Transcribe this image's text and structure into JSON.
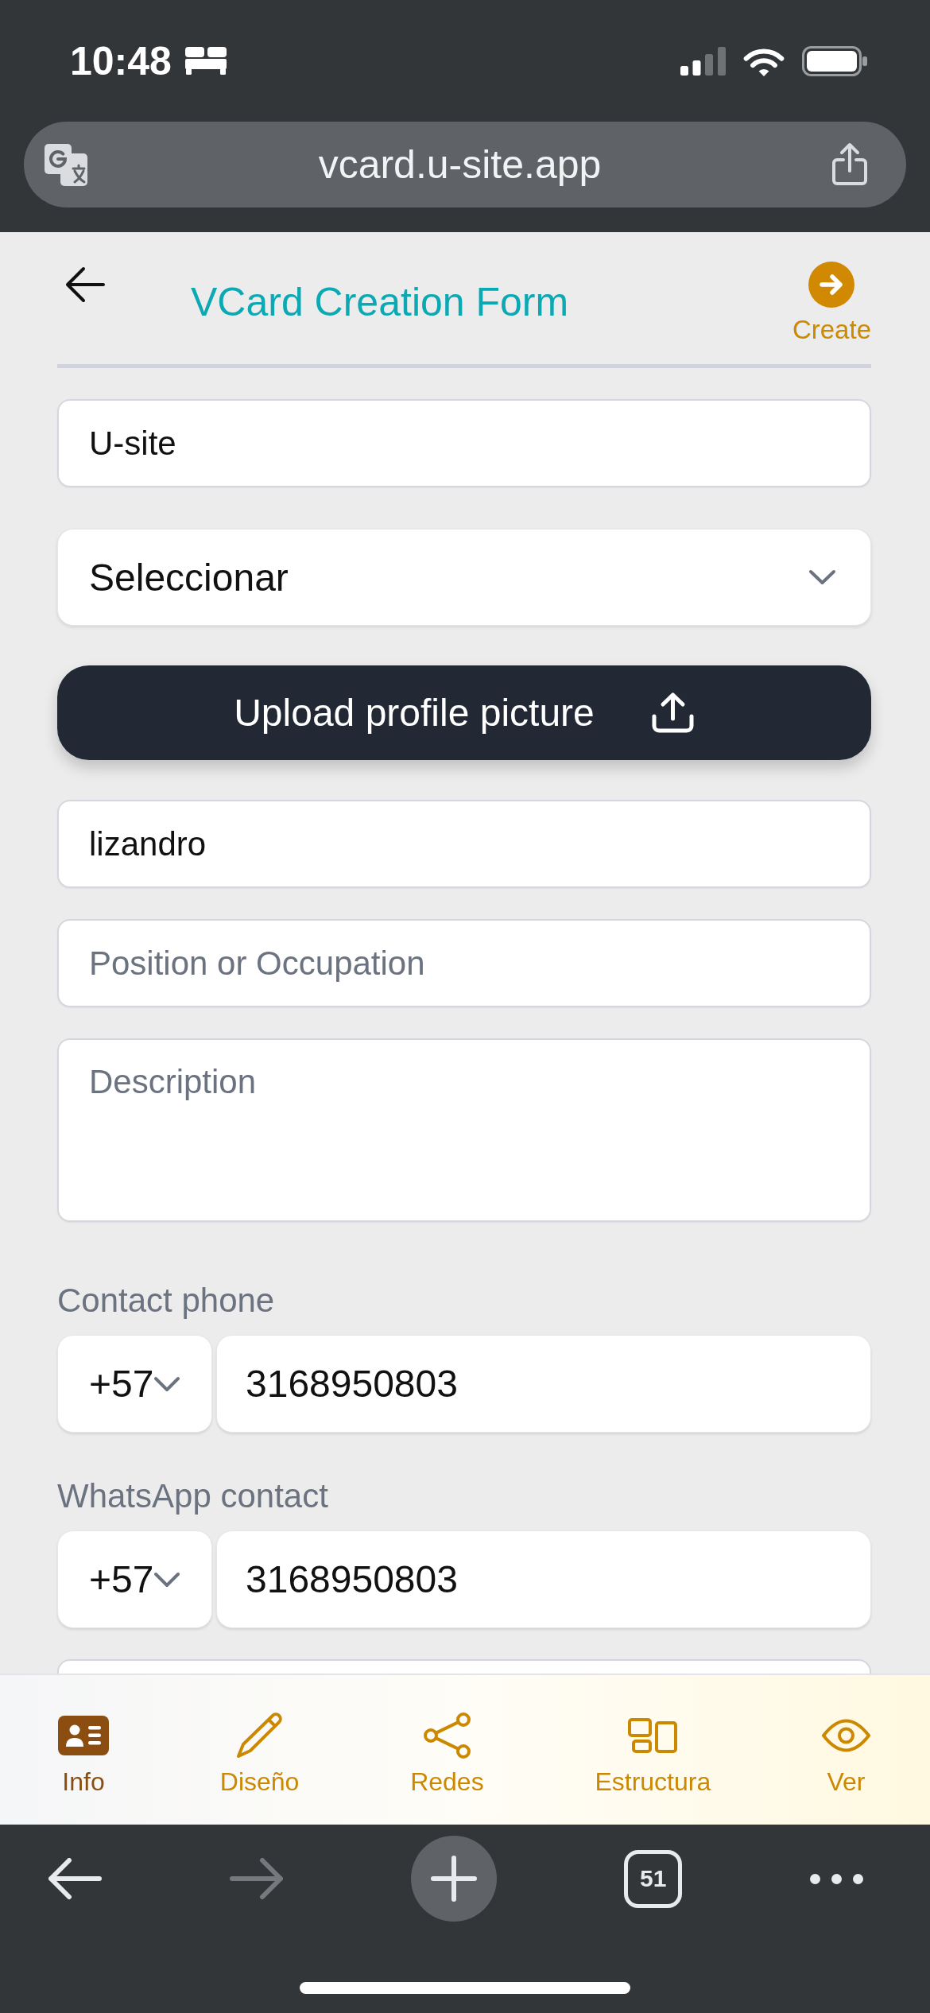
{
  "status_bar": {
    "time": "10:48"
  },
  "address_bar": {
    "url": "vcard.u-site.app"
  },
  "header": {
    "title": "VCard Creation Form",
    "action": "Create"
  },
  "form": [
    {
      "kind": "input",
      "value": "U-site"
    },
    {
      "kind": "select",
      "value": "Seleccionar"
    },
    {
      "kind": "upload",
      "label": "Upload profile picture"
    },
    {
      "kind": "input",
      "value": "lizandro"
    },
    {
      "kind": "input",
      "placeholder": "Position or Occupation"
    },
    {
      "kind": "textarea",
      "placeholder": "Description"
    },
    {
      "kind": "phone",
      "label": "Contact phone",
      "code": "+57",
      "number": "3168950803"
    },
    {
      "kind": "phone",
      "label": "WhatsApp contact",
      "code": "+57",
      "number": "3168950803"
    },
    {
      "kind": "input"
    }
  ],
  "bottom_nav": [
    {
      "label": "Info",
      "selected": true
    },
    {
      "label": "Diseño",
      "selected": false
    },
    {
      "label": "Redes",
      "selected": false
    },
    {
      "label": "Estructura",
      "selected": false
    },
    {
      "label": "Ver",
      "selected": false
    }
  ],
  "browser_toolbar": [
    {
      "kind": "back",
      "disabled": false
    },
    {
      "kind": "forward",
      "disabled": true
    },
    {
      "kind": "new_tab",
      "disabled": false
    },
    {
      "kind": "tabs",
      "count": "51",
      "disabled": false
    },
    {
      "kind": "more",
      "disabled": false
    }
  ]
}
